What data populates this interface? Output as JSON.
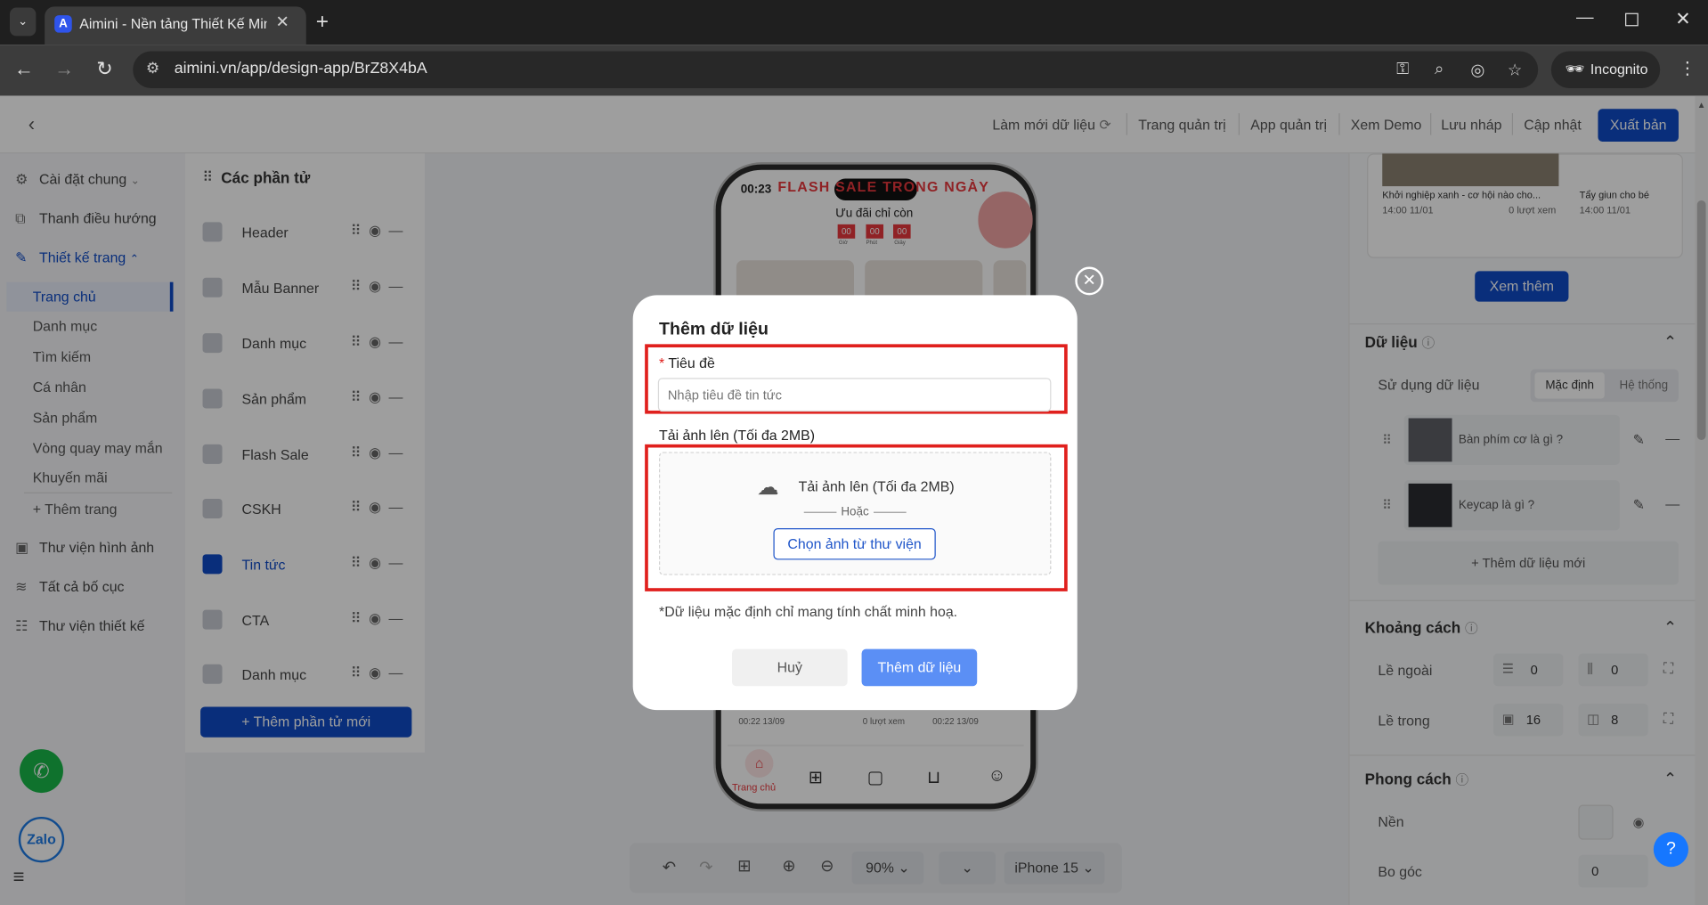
{
  "browser": {
    "tab_title": "Aimini - Nền tảng Thiết Kế Mini",
    "url": "aimini.vn/app/design-app/BrZ8X4bA",
    "incognito_label": "Incognito"
  },
  "header": {
    "refresh": "Làm mới dữ liệu",
    "admin_page": "Trang quản trị",
    "admin_app": "App quản trị",
    "demo": "Xem Demo",
    "save_draft": "Lưu nháp",
    "update": "Cập nhật",
    "publish": "Xuất bản"
  },
  "sidebar": {
    "general": "Cài đặt chung",
    "nav": "Thanh điều hướng",
    "design": "Thiết kế trang",
    "pages": [
      "Trang chủ",
      "Danh mục",
      "Tìm kiếm",
      "Cá nhân",
      "Sản phẩm",
      "Vòng quay may mắn",
      "Khuyến mãi"
    ],
    "add_page": "+ Thêm trang",
    "image_lib": "Thư viện hình ảnh",
    "layouts": "Tất cả bố cục",
    "design_lib": "Thư viện thiết kế"
  },
  "elements": {
    "title": "Các phần tử",
    "items": [
      "Header",
      "Mẫu Banner",
      "Danh mục",
      "Sản phẩm",
      "Flash Sale",
      "CSKH",
      "Tin tức",
      "CTA",
      "Danh mục"
    ],
    "add_button": "+ Thêm phần tử mới"
  },
  "phone": {
    "time": "00:23",
    "flash_title": "FLASH SALE TRONG NGÀY",
    "offer": "Ưu đãi chỉ còn",
    "countdown": [
      "00",
      "00",
      "00"
    ],
    "countdown_units": [
      "Giờ",
      "Phút",
      "Giây"
    ],
    "news_meta1": "00:22 13/09",
    "news_views": "0 lượt xem",
    "news_meta2": "00:22 13/09",
    "bottom_home": "Trang chủ"
  },
  "zoombar": {
    "zoom": "90%",
    "device": "iPhone 15"
  },
  "right_panel": {
    "news1_title": "Khởi nghiệp xanh - cơ hội nào cho...",
    "news1_time": "14:00 11/01",
    "news1_views": "0 lượt xem",
    "news2_title": "Tẩy giun cho bé",
    "news2_time": "14:00 11/01",
    "more": "Xem thêm",
    "data_section": "Dữ liệu",
    "use_data": "Sử dụng dữ liệu",
    "opt_default": "Mặc định",
    "opt_system": "Hệ thống",
    "data_items": [
      "Bàn phím cơ là gì ?",
      "Keycap là gì ?"
    ],
    "add_data": "+ Thêm dữ liệu mới",
    "spacing": "Khoảng cách",
    "outer": "Lề ngoài",
    "inner": "Lề trong",
    "outer_v": "0",
    "outer_h": "0",
    "inner_v": "16",
    "inner_h": "8",
    "style": "Phong cách",
    "bg": "Nền",
    "radius": "Bo góc",
    "radius_v": "0"
  },
  "modal": {
    "title": "Thêm dữ liệu",
    "field_label": "Tiêu đề",
    "field_placeholder": "Nhập tiêu đề tin tức",
    "upload_label": "Tải ảnh lên (Tối đa 2MB)",
    "upload_text": "Tải ảnh lên (Tối đa 2MB)",
    "or": "Hoặc",
    "pick_library": "Chọn ảnh từ thư viện",
    "note": "*Dữ liệu mặc định chỉ mang tính chất minh hoạ.",
    "cancel": "Huỷ",
    "submit": "Thêm dữ liệu"
  },
  "widgets": {
    "zalo": "Zalo",
    "help": "?"
  },
  "colors": {
    "primary": "#0f4bc7",
    "highlight": "#e0201d",
    "flash_red": "#e8383d"
  }
}
